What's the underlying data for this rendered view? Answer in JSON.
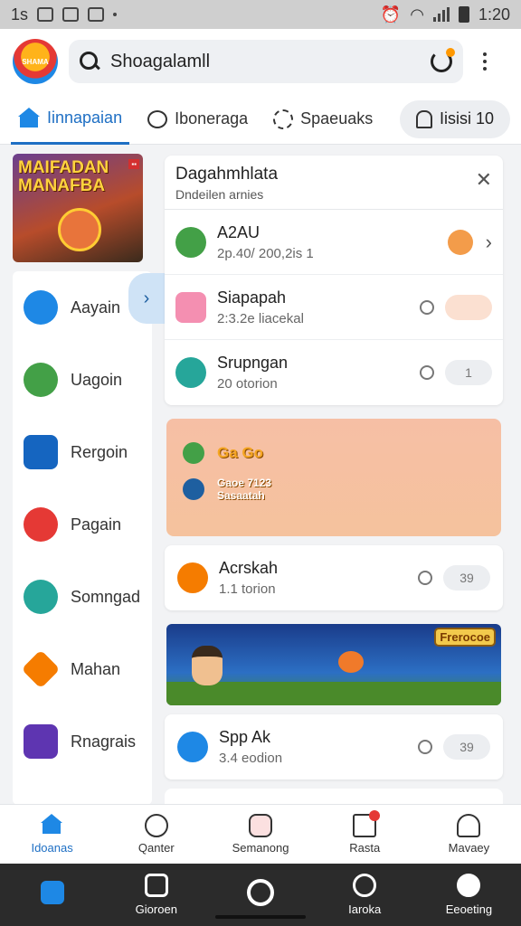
{
  "status_bar": {
    "left_text": "1s",
    "time": "1:20"
  },
  "header": {
    "logo_text": "SHAMA",
    "search": {
      "value": "Shoagalamll"
    }
  },
  "tabs": [
    {
      "label": "Iinnapaian"
    },
    {
      "label": "Iboneraga"
    },
    {
      "label": "Spaeuaks"
    },
    {
      "label": "Iisisi 10"
    }
  ],
  "sidebar": {
    "banner_title": "MAIFADAN MANAFBA",
    "items": [
      {
        "label": "Aayain",
        "color": "#1e88e5"
      },
      {
        "label": "Uagoin",
        "color": "#43a047"
      },
      {
        "label": "Rergoin",
        "color": "#1565c0"
      },
      {
        "label": "Pagain",
        "color": "#e53935"
      },
      {
        "label": "Somngad",
        "color": "#26a69a"
      },
      {
        "label": "Mahan",
        "color": "#f57c00"
      },
      {
        "label": "Rnagrais",
        "color": "#5e35b1"
      }
    ]
  },
  "panel": {
    "title": "Dagahmhlata",
    "subtitle": "Dndeilen arnies",
    "rows": [
      {
        "title": "A2AU",
        "sub": "2p.40/ 200,2is 1",
        "icon_color": "#43a047"
      },
      {
        "title": "Siapapah",
        "sub": "2:3.2e liacekal",
        "pill": "",
        "icon_color": "#f48fb1"
      },
      {
        "title": "Srupngan",
        "sub": "20 otorion",
        "pill": "1",
        "icon_color": "#26a69a"
      }
    ]
  },
  "promo": {
    "line1": "Ga Go",
    "line2a": "Gaoe 7123",
    "line2b": "Sasaatah"
  },
  "cards": [
    {
      "title": "Acrskah",
      "sub": "1.1 torion",
      "pill": "39",
      "icon_color": "#f57c00"
    },
    {
      "title": "Spp Ak",
      "sub": "3.4 eodion",
      "pill": "39",
      "icon_color": "#1e88e5"
    }
  ],
  "game_banner": {
    "logo": "Frerocoe"
  },
  "bottom_nav": [
    {
      "label": "Idoanas"
    },
    {
      "label": "Qanter"
    },
    {
      "label": "Semanong"
    },
    {
      "label": "Rasta"
    },
    {
      "label": "Mavaey"
    }
  ],
  "system_nav": [
    {
      "label": ""
    },
    {
      "label": "Gioroen"
    },
    {
      "label": ""
    },
    {
      "label": "Iaroka"
    },
    {
      "label": "Eeoeting"
    }
  ]
}
